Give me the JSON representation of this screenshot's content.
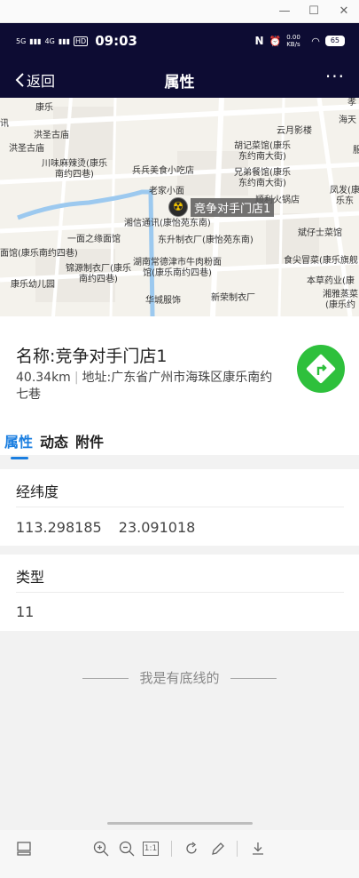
{
  "status_bar": {
    "signal1": "5G",
    "signal2": "4G",
    "hd": "HD",
    "time": "09:03",
    "nfc": "N",
    "alarm": "⏰",
    "speed": "0.00 KB/s",
    "battery": "65"
  },
  "nav": {
    "back_label": "返回",
    "title": "属性",
    "more": "···"
  },
  "map": {
    "pin_label": "竞争对手门店1",
    "labels": [
      "康乐",
      "洪圣古庙",
      "洪圣古庙",
      "云月影楼",
      "胡记菜馆(康乐东约南大街)",
      "川味麻辣烫(康乐南约四巷)",
      "兵兵美食小吃店",
      "兄弟餐馆(康乐东约南大街)",
      "老家小面",
      "顺利火锅店",
      "凤发(康乐东",
      "湘信通讯(康怡苑东南)",
      "一面之缘面馆",
      "东升制衣厂(康怡苑东南)",
      "斌仔士菜馆",
      "面馆(康乐南约四巷)",
      "锦源制衣厂(康乐南约四巷)",
      "湖南常德津市牛肉粉面馆(康乐南约四巷)",
      "食尖冒菜(康乐旗舰",
      "康乐幼儿园",
      "本草药业(康",
      "湘雅蒸菜(康乐约",
      "华城服饰",
      "新荣制衣厂",
      "海天",
      "讯",
      "孝",
      "服"
    ]
  },
  "poi": {
    "name": "名称:竞争对手门店1",
    "distance": "40.34km",
    "address": "地址:广东省广州市海珠区康乐南约七巷"
  },
  "tabs": [
    {
      "label": "属性",
      "active": true
    },
    {
      "label": "动态",
      "active": false
    },
    {
      "label": "附件",
      "active": false
    }
  ],
  "properties": [
    {
      "title": "经纬度",
      "value": "113.298185 23.091018"
    },
    {
      "title": "类型",
      "value": "11"
    }
  ],
  "footer_text": "我是有底线的",
  "toolbar": {
    "zoom_fit": "1:1"
  },
  "colors": {
    "header_bg": "#0d0c33",
    "accent": "#1a7ee0",
    "nav_button": "#2ec03c"
  }
}
